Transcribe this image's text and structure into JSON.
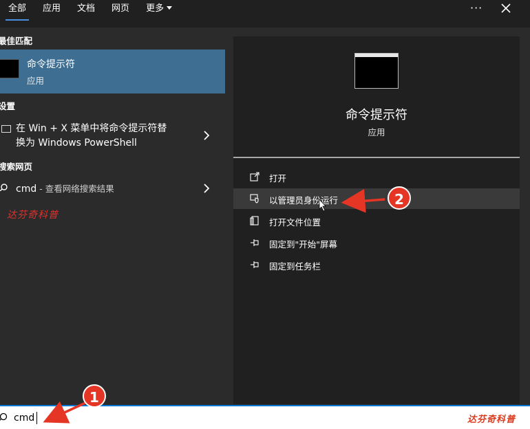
{
  "tabs": [
    {
      "label": "全部",
      "active": true
    },
    {
      "label": "应用"
    },
    {
      "label": "文档"
    },
    {
      "label": "网页"
    },
    {
      "label": "更多"
    }
  ],
  "left": {
    "best_match_title": "最佳匹配",
    "best_match": {
      "title": "命令提示符",
      "subtitle": "应用"
    },
    "settings_title": "设置",
    "settings_item": {
      "line1": "在 Win + X 菜单中将命令提示符替",
      "line2": "换为 Windows PowerShell"
    },
    "web_title": "搜索网页",
    "web_item": {
      "query": "cmd",
      "suffix": " - 查看网络搜索结果"
    },
    "watermark": "达芬奇科普"
  },
  "right": {
    "title": "命令提示符",
    "subtitle": "应用",
    "actions": [
      {
        "label": "打开",
        "icon": "open-icon"
      },
      {
        "label": "以管理员身份运行",
        "icon": "shield-icon"
      },
      {
        "label": "打开文件位置",
        "icon": "file-icon"
      },
      {
        "label": "固定到\"开始\"屏幕",
        "icon": "pin-icon"
      },
      {
        "label": "固定到任务栏",
        "icon": "pin-icon"
      }
    ]
  },
  "search": {
    "value": "cmd"
  },
  "annotations": {
    "badge1": "1",
    "badge2": "2"
  },
  "watermark_bottom": "达芬奇科普",
  "colors": {
    "accent": "#0078d7",
    "selected": "#3e6f93",
    "annotation": "#e53524"
  }
}
